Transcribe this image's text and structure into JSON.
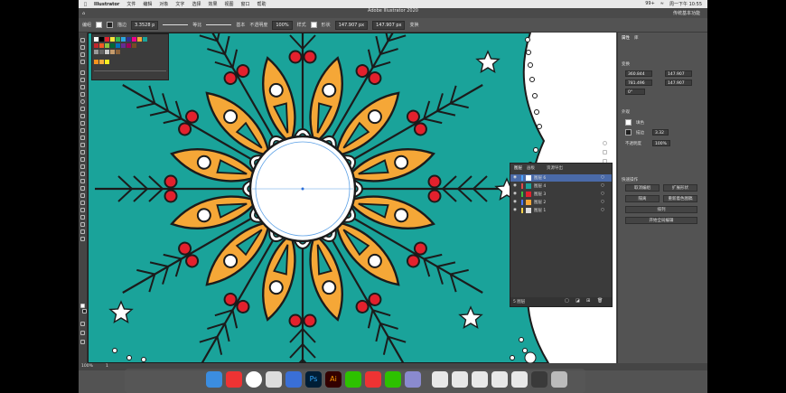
{
  "menubar": {
    "app_name": "Illustrator",
    "items": [
      "文件",
      "编辑",
      "对象",
      "文字",
      "选择",
      "效果",
      "视图",
      "窗口",
      "帮助"
    ],
    "status_right": "周一下午 10:55",
    "status_user": "99+"
  },
  "titlebar": {
    "doc_title": "Adobe Illustrator 2020",
    "workspace_label": "传统基本功能"
  },
  "control_bar": {
    "selection_label": "编组",
    "stroke_label": "描边",
    "stroke_weight": "3.3528 p",
    "stroke_style": "等比",
    "brush_label": "基本",
    "opacity_label": "不透明度",
    "opacity_value": "100%",
    "style_label": "样式",
    "shape_label": "形状",
    "w_value": "147.907 px",
    "h_value": "147.907 px",
    "transform_label": "变换"
  },
  "right_panel": {
    "tabs": [
      "属性",
      "库"
    ],
    "section_transform": "变换",
    "x_value": "360.844",
    "y_value": "781.496",
    "w_value": "147.907",
    "h_value": "147.907",
    "angle_value": "0°",
    "section_appearance": "外观",
    "fill_label": "填色",
    "stroke_label": "描边",
    "stroke_value": "3.32",
    "opacity_label": "不透明度",
    "opacity_value": "100%",
    "section_quick": "快速操作",
    "btn_ungroup": "取消编组",
    "btn_expand": "扩展形状",
    "btn_isolate": "隔离",
    "btn_recolor": "重新着色图稿",
    "btn_arrange": "排列",
    "btn_start_repeat": "开始全局编辑"
  },
  "layers_panel": {
    "tabs": [
      "图层",
      "画板",
      "资源导出"
    ],
    "rows": [
      "图层 6",
      "图层 4",
      "图层 3",
      "图层 2",
      "图层 1"
    ],
    "footer": "5 图层"
  },
  "status_bar": {
    "zoom": "100%",
    "page": "1"
  },
  "colors": {
    "teal": "#1aa39a",
    "orange": "#f5a737",
    "red": "#e3212d",
    "outline": "#1b1b1b",
    "white": "#ffffff",
    "ui_bg": "#535353"
  }
}
